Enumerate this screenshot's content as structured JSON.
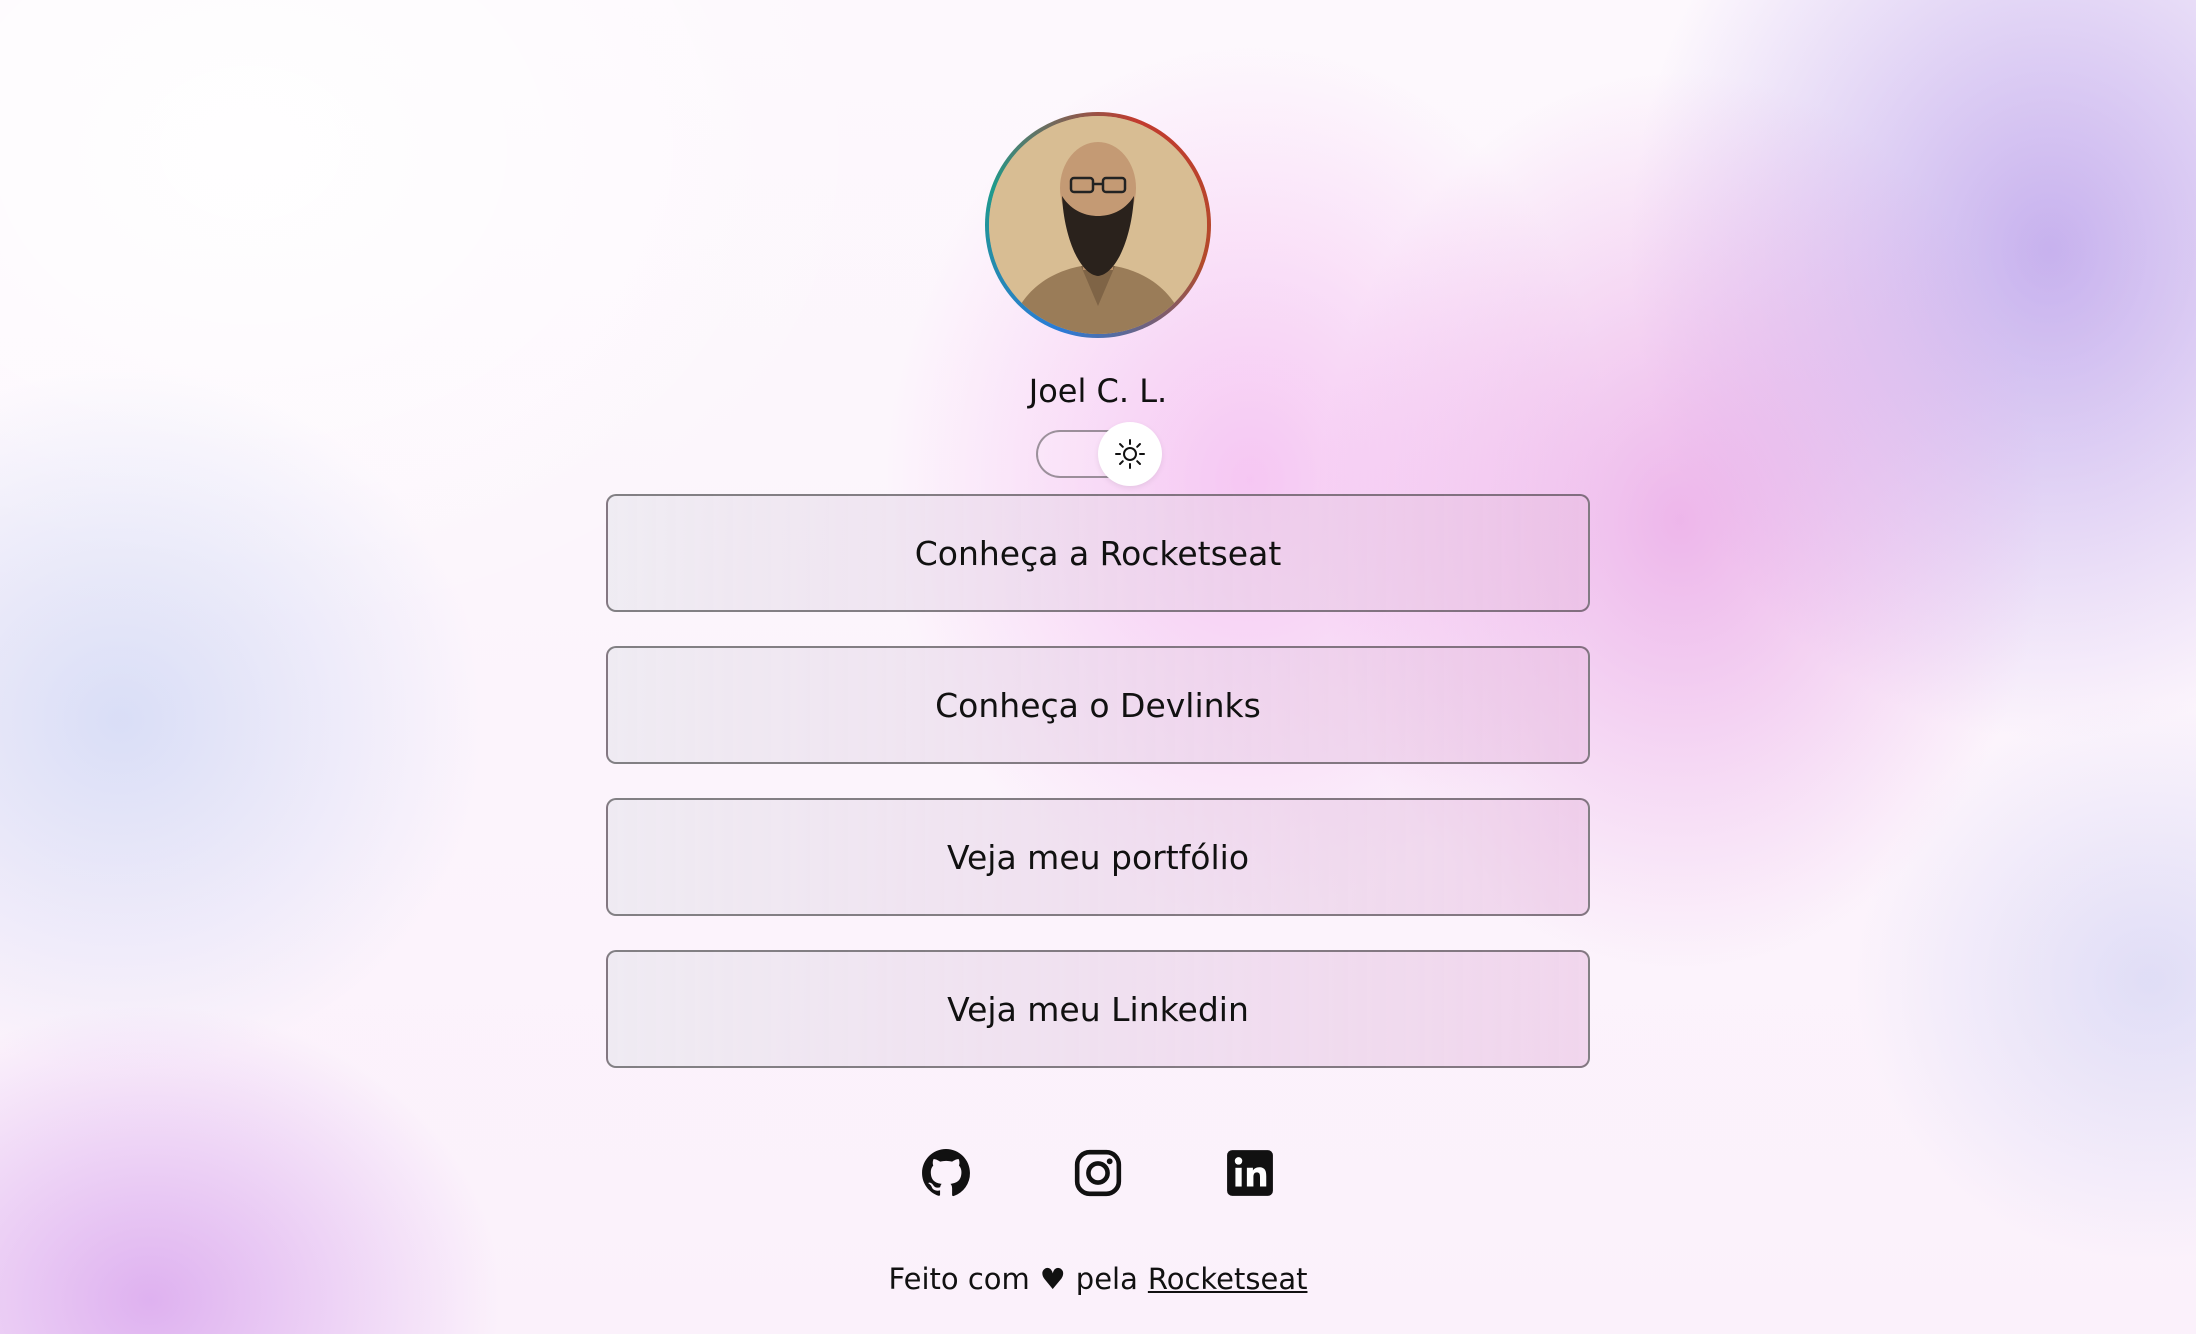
{
  "profile": {
    "name": "Joel C. L.",
    "avatar_alt": "Joel C. L."
  },
  "theme_switch": {
    "icon": "sun-icon",
    "state": "light"
  },
  "links": [
    {
      "label": "Conheça a Rocketseat"
    },
    {
      "label": "Conheça o Devlinks"
    },
    {
      "label": "Veja meu portfólio"
    },
    {
      "label": "Veja meu Linkedin"
    }
  ],
  "social": [
    {
      "icon": "github-icon"
    },
    {
      "icon": "instagram-icon"
    },
    {
      "icon": "linkedin-icon"
    }
  ],
  "footer": {
    "prefix": "Feito com",
    "heart": "♥",
    "middle": "pela",
    "link_label": "Rocketseat"
  },
  "colors": {
    "accent_purple": "#c89ae6",
    "accent_pink": "#f0a8e8",
    "text": "#111111"
  }
}
